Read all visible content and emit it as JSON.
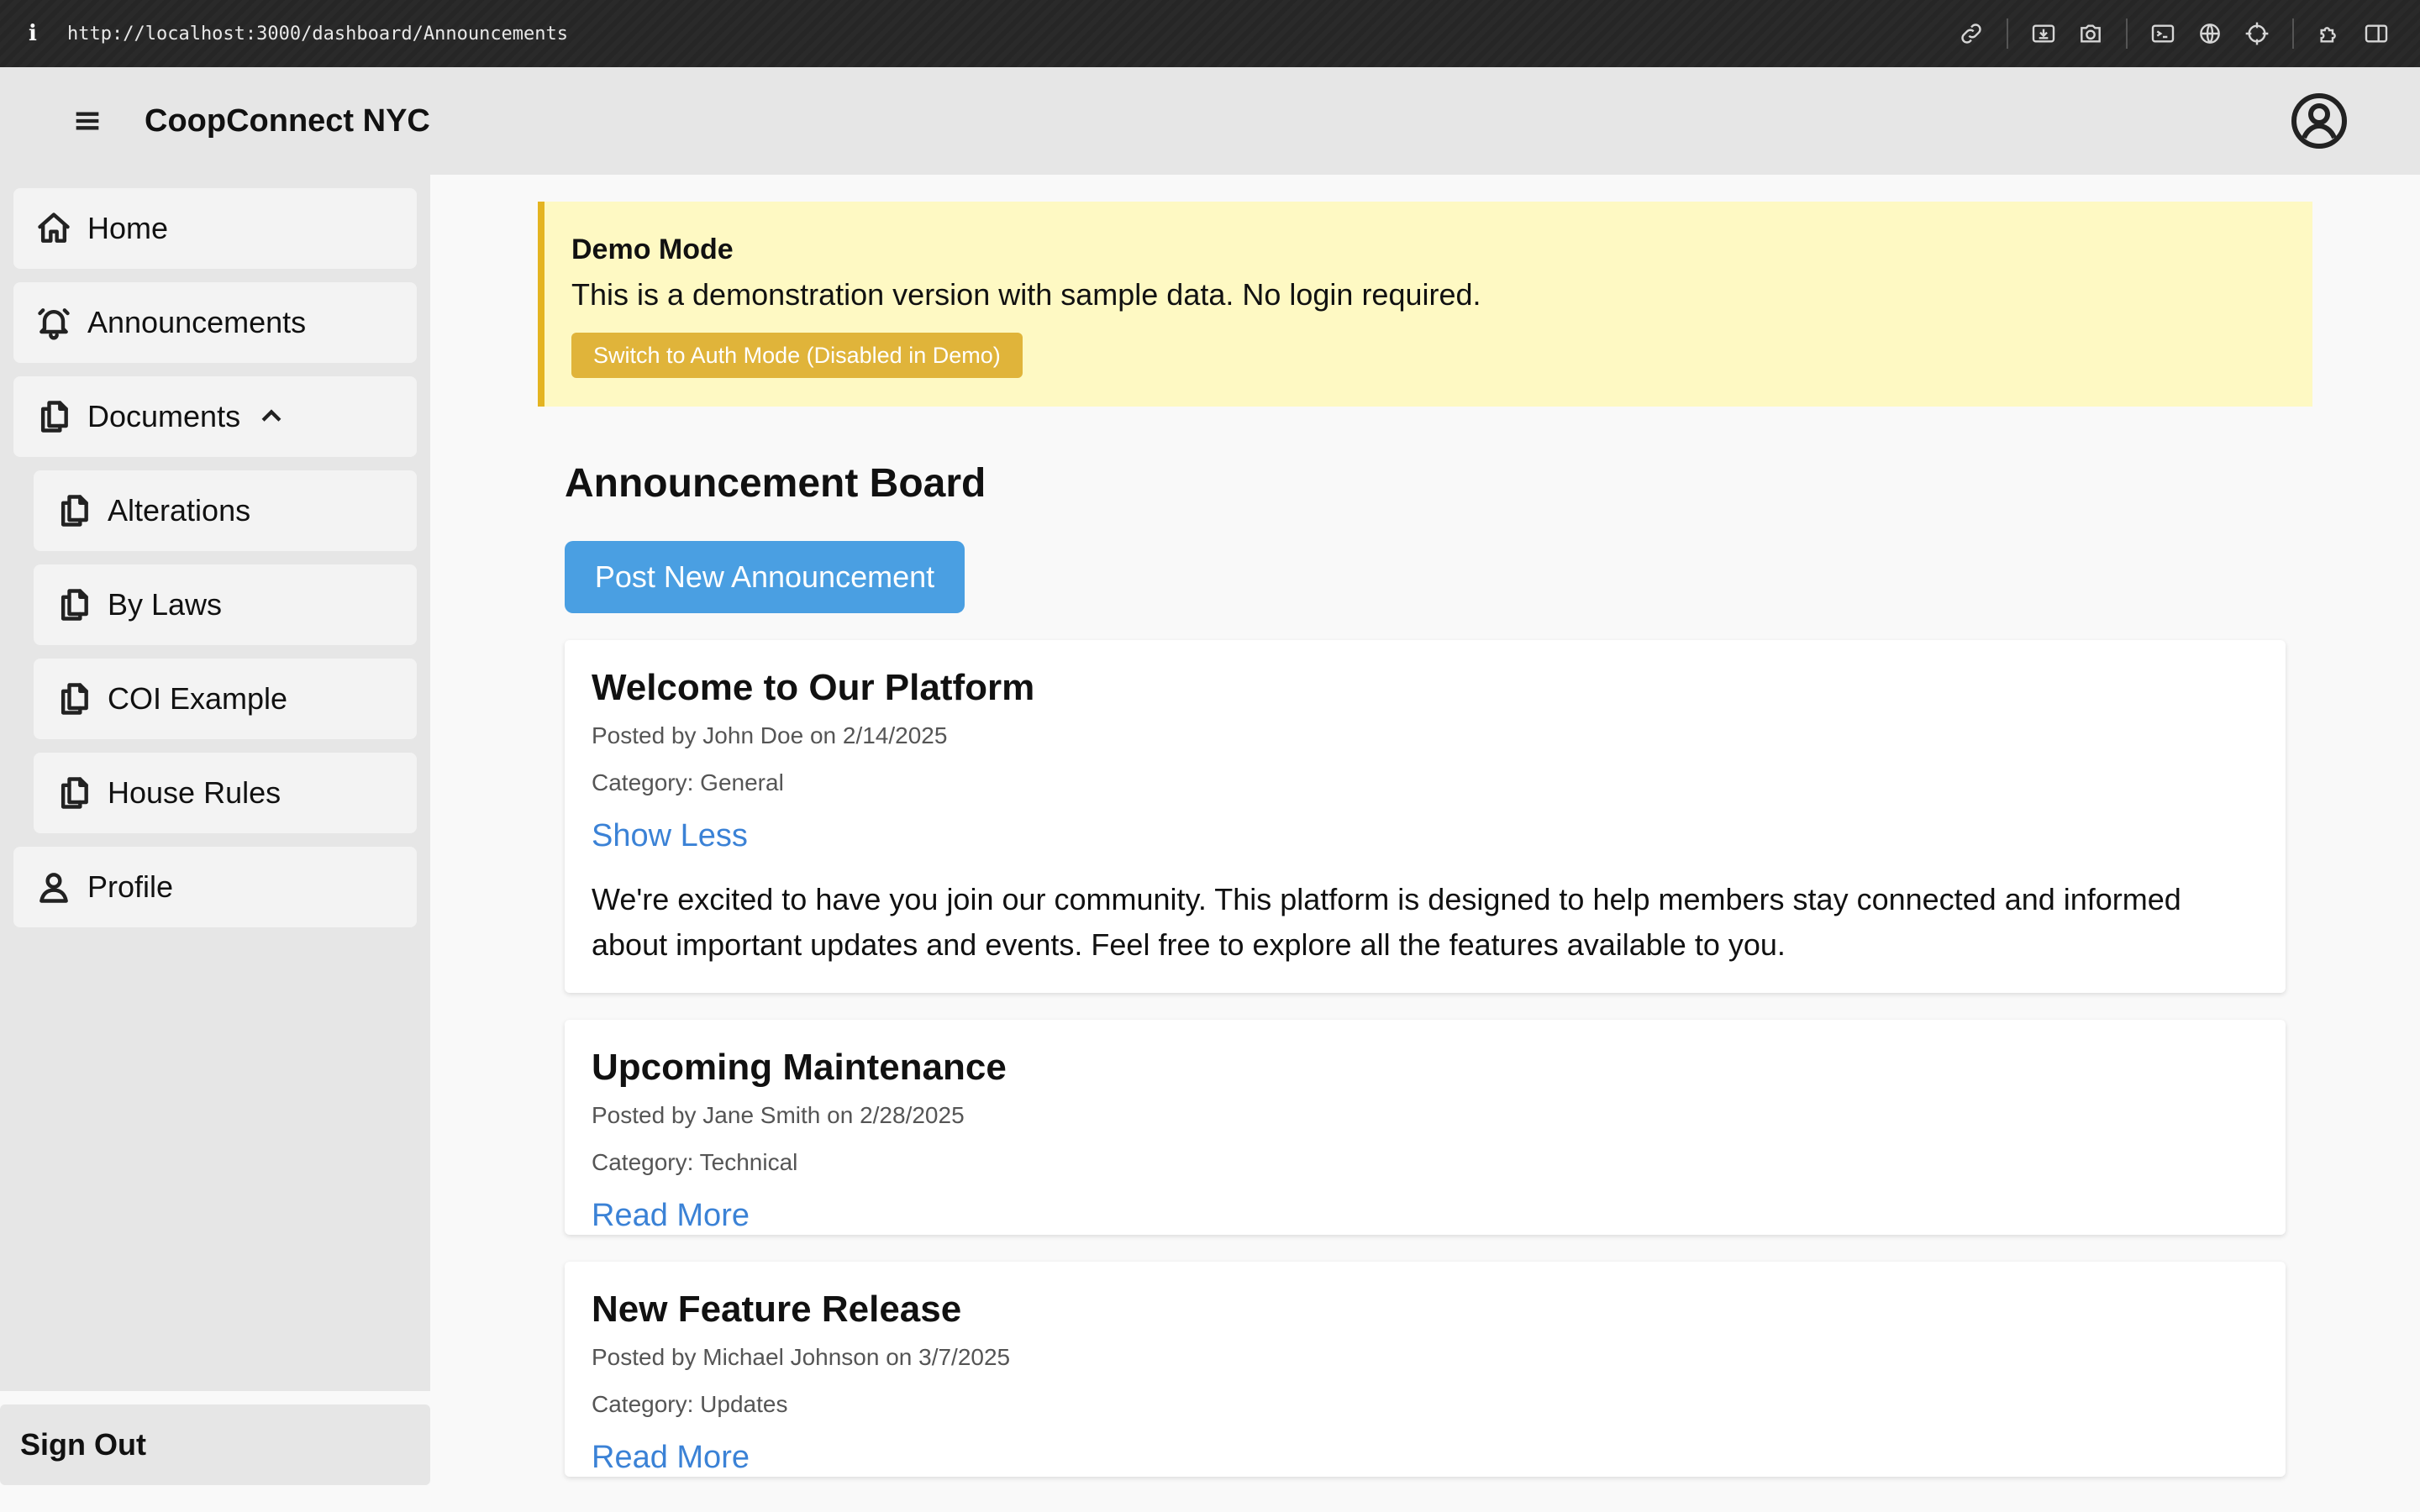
{
  "browser": {
    "url": "http://localhost:3000/dashboard/Announcements",
    "info_glyph": "i",
    "tools": [
      "link-icon",
      "download-icon",
      "camera-icon",
      "terminal-icon",
      "globe-icon",
      "crosshair-icon",
      "extension-icon",
      "sidebar-icon"
    ]
  },
  "header": {
    "title": "CoopConnect NYC"
  },
  "sidebar": {
    "items": [
      {
        "label": "Home",
        "icon": "home-icon"
      },
      {
        "label": "Announcements",
        "icon": "bell-icon"
      },
      {
        "label": "Documents",
        "icon": "documents-icon"
      },
      {
        "label": "Alterations",
        "icon": "documents-icon"
      },
      {
        "label": "By Laws",
        "icon": "documents-icon"
      },
      {
        "label": "COI Example",
        "icon": "documents-icon"
      },
      {
        "label": "House Rules",
        "icon": "documents-icon"
      },
      {
        "label": "Profile",
        "icon": "user-icon"
      }
    ],
    "sign_out": "Sign Out"
  },
  "demo": {
    "title": "Demo Mode",
    "text": "This is a demonstration version with sample data. No login required.",
    "button": "Switch to Auth Mode (Disabled in Demo)",
    "colors": {
      "background": "#fef9c3",
      "accent": "#e4b421"
    }
  },
  "main": {
    "title": "Announcement Board",
    "post_button": "Post New Announcement",
    "accent": "#4a9fe2"
  },
  "announcements": [
    {
      "title": "Welcome to Our Platform",
      "meta": "Posted by John Doe on 2/14/2025",
      "category": "Category: General",
      "link": "Show Less",
      "body": "We're excited to have you join our community. This platform is designed to help members stay connected and informed about important updates and events. Feel free to explore all the features available to you."
    },
    {
      "title": "Upcoming Maintenance",
      "meta": "Posted by Jane Smith on 2/28/2025",
      "category": "Category: Technical",
      "link": "Read More"
    },
    {
      "title": "New Feature Release",
      "meta": "Posted by Michael Johnson on 3/7/2025",
      "category": "Category: Updates",
      "link": "Read More"
    }
  ]
}
